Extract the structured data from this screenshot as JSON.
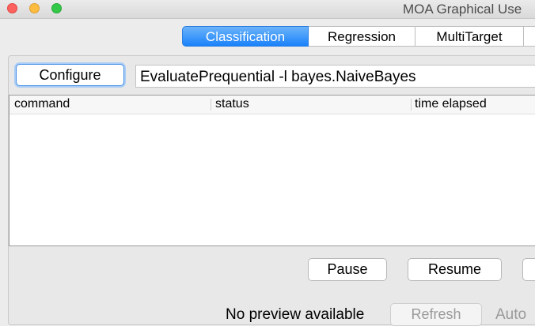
{
  "window": {
    "title": "MOA Graphical Use"
  },
  "tabs": [
    {
      "label": "Classification",
      "selected": true
    },
    {
      "label": "Regression",
      "selected": false
    },
    {
      "label": "MultiTarget",
      "selected": false
    },
    {
      "label": "",
      "selected": false
    }
  ],
  "task": {
    "configure_label": "Configure",
    "command_value": "EvaluatePrequential -l bayes.NaiveBayes"
  },
  "table": {
    "columns": [
      "command",
      "status",
      "time elapsed"
    ],
    "rows": []
  },
  "controls": {
    "pause_label": "Pause",
    "resume_label": "Resume"
  },
  "preview": {
    "message": "No preview available",
    "refresh_label": "Refresh",
    "auto_label": "Auto"
  },
  "colors": {
    "accent": "#1a82fb",
    "window_bg": "#ececec"
  }
}
